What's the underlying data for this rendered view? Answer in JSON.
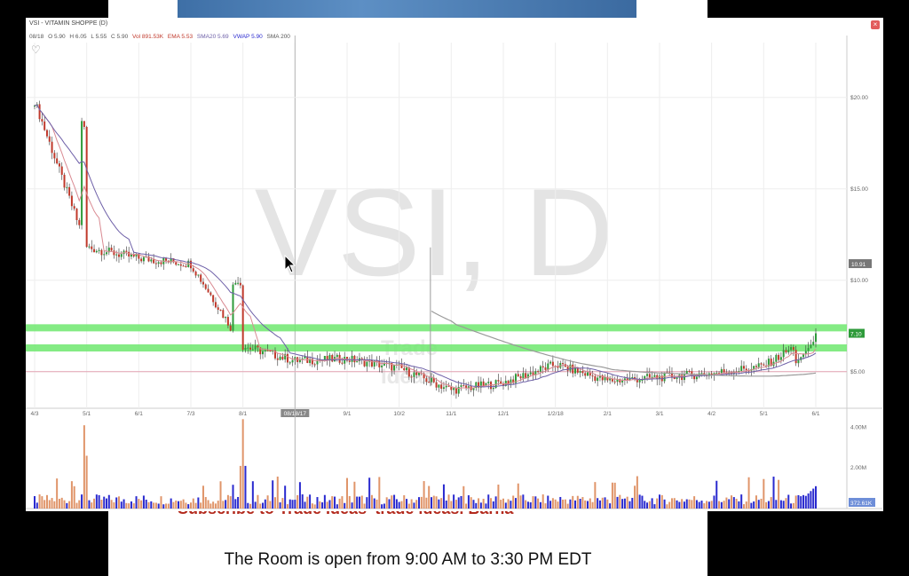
{
  "window": {
    "title": "VSI - VITAMIN SHOPPE (D)",
    "close_label": "×"
  },
  "info_bar": {
    "date": "08/18",
    "open": "O 5.90",
    "high": "H 6.05",
    "low": "L 5.55",
    "close": "C 5.90",
    "vol": "Vol 891.53K",
    "ema": "EMA 5.53",
    "sma20": "SMA20 5.69",
    "vwap": "VWAP 5.90",
    "sma200": "SMA 200"
  },
  "watermark": "VSI, D",
  "logo_text_line1": "Trade",
  "logo_text_line2": "Ideas",
  "slide": {
    "caption": "The Room is open from 9:00 AM to 3:30 PM EDT",
    "hidden_caption": "Subscribe to Trade Ideas' trade ideas, Barna"
  },
  "colors": {
    "up": "#2e9b3a",
    "down": "#c0392b",
    "ma_fast": "#d98a92",
    "ma_slow": "#6e60a8",
    "sma200": "#9a9a9a",
    "support_band": "#6ee86e",
    "vol_up": "#2a2acf",
    "vol_down": "#e0956a"
  },
  "chart_data": [
    {
      "type": "candlestick",
      "title": "VSI - VITAMIN SHOPPE (D)",
      "xlabel": "",
      "ylabel": "",
      "x_ticks": [
        "4/3",
        "5/1",
        "6/1",
        "7/3",
        "8/1",
        "08/18/17",
        "9/1",
        "10/2",
        "11/1",
        "12/1",
        "1/2/18",
        "2/1",
        "3/1",
        "4/2",
        "5/1",
        "6/1"
      ],
      "y_ticks": [
        "$20.00",
        "$15.00",
        "$10.00",
        "$5.00"
      ],
      "ylim": [
        3,
        23
      ],
      "price_labels": {
        "crosshair": "10.91",
        "current": "7.10"
      },
      "support_levels": [
        7.4,
        6.3
      ],
      "resistance_line": 5.0,
      "monthly_closes": [
        {
          "x": 0,
          "close": 19.8
        },
        {
          "x": 1,
          "close": 11.8
        },
        {
          "x": 2,
          "close": 11.2
        },
        {
          "x": 3,
          "close": 10.9
        },
        {
          "x": 4,
          "close": 6.4
        },
        {
          "x": 5,
          "close": 5.6
        },
        {
          "x": 6,
          "close": 5.7
        },
        {
          "x": 7,
          "close": 5.2
        },
        {
          "x": 8,
          "close": 4.0
        },
        {
          "x": 9,
          "close": 4.4
        },
        {
          "x": 10,
          "close": 5.4
        },
        {
          "x": 11,
          "close": 4.5
        },
        {
          "x": 12,
          "close": 4.7
        },
        {
          "x": 13,
          "close": 4.9
        },
        {
          "x": 14,
          "close": 5.3
        },
        {
          "x": 15,
          "close": 7.1
        }
      ]
    },
    {
      "type": "bar",
      "title": "",
      "xlabel": "",
      "ylabel": "Volume",
      "y_ticks": [
        "4.00M",
        "2.00M"
      ],
      "ylim": [
        0,
        4.5
      ],
      "current_label": "372.61K"
    }
  ]
}
